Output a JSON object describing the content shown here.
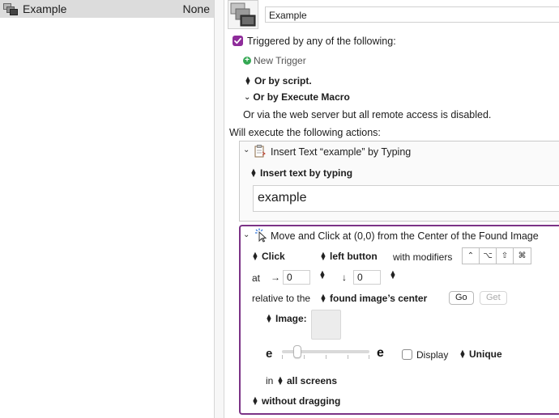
{
  "macro_list": {
    "row": {
      "name": "Example",
      "hotkey": "None"
    }
  },
  "editor": {
    "macro_name": "Example",
    "triggers": {
      "header": "Triggered by any of the following:",
      "new_trigger": "New Trigger",
      "by_script": "Or by script.",
      "by_execute_macro": "Or by Execute Macro",
      "web_server": "Or via the web server but all remote access is disabled."
    },
    "actions_header": "Will execute the following actions:",
    "action1": {
      "title": "Insert Text “example” by Typing",
      "mode": "Insert text by typing",
      "text_value": "example"
    },
    "action2": {
      "title": "Move and Click at (0,0) from the Center of the Found Image",
      "click_type": "Click",
      "button": "left button",
      "with_modifiers": "with modifiers",
      "at_label": "at",
      "x_arrow": "→",
      "x_value": "0",
      "y_arrow": "↓",
      "y_value": "0",
      "relative_label": "relative to the",
      "relative_to": "found image’s center",
      "go": "Go",
      "get": "Get",
      "image_label": "Image:",
      "fuzz_low": "e",
      "fuzz_high": "e",
      "display_label": "Display",
      "unique": "Unique",
      "in_label": "in",
      "screens": "all screens",
      "dragging": "without dragging"
    }
  },
  "colors": {
    "accent": "#8e2c9a",
    "selected_row": "#dcdcdc",
    "new_trigger_icon": "#34a853"
  },
  "icons": [
    "macro-group-icon",
    "checkbox-checked-icon",
    "plus-circle-icon",
    "up-down-arrows-icon",
    "chevron-down-icon",
    "clipboard-icon",
    "cursor-click-icon",
    "shift-icon",
    "option-icon",
    "control-icon",
    "command-icon"
  ]
}
